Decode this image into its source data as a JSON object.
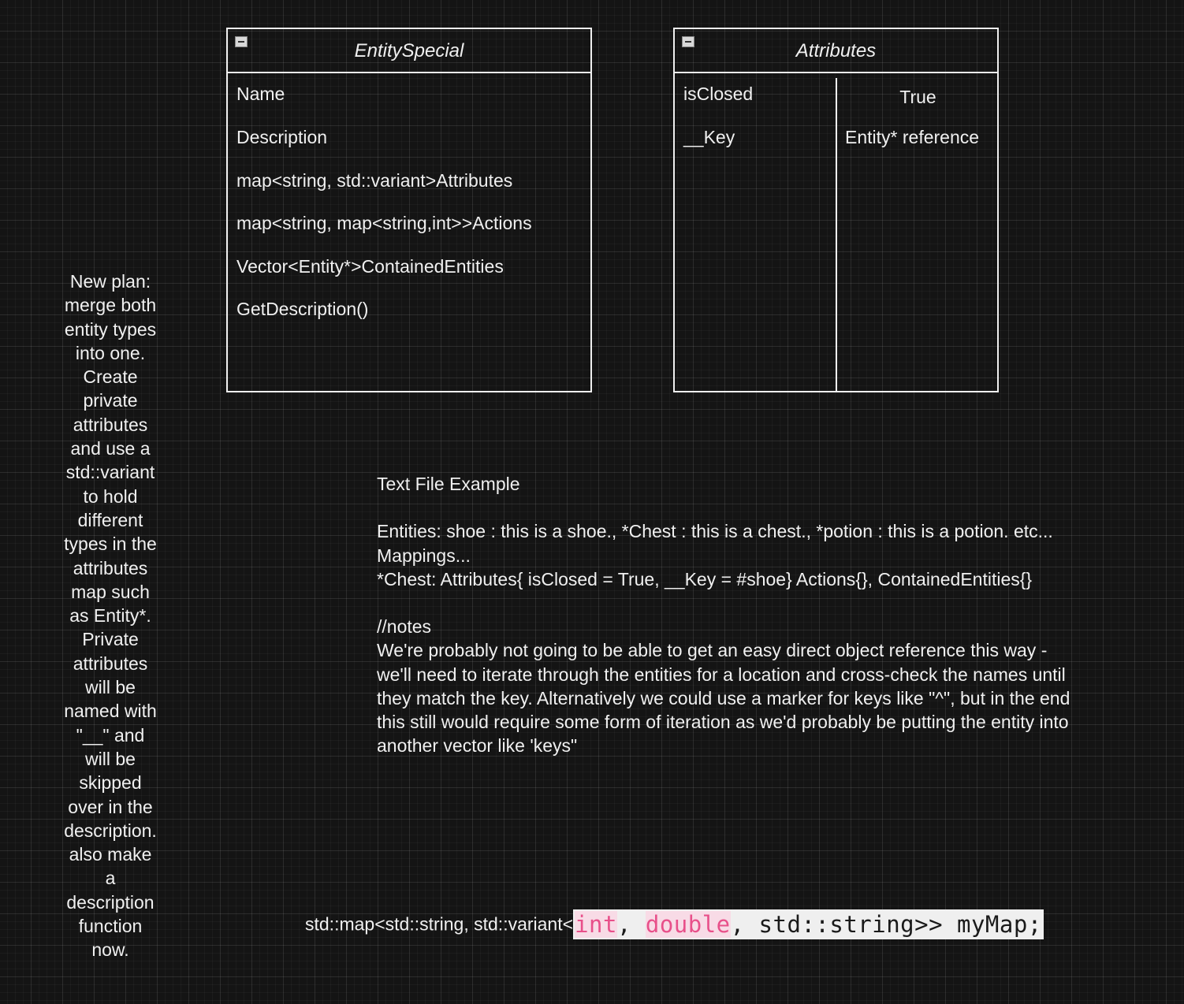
{
  "entity_box": {
    "title": "EntitySpecial",
    "rows": [
      "Name",
      "Description",
      "map<string, std::variant>Attributes",
      "map<string, map<string,int>>Actions",
      "Vector<Entity*>ContainedEntities",
      "GetDescription()"
    ]
  },
  "attributes_box": {
    "title": "Attributes",
    "keys": [
      "isClosed",
      "__Key"
    ],
    "values": [
      "True",
      "Entity* reference"
    ]
  },
  "side_note": {
    "lines": [
      "New plan:",
      "merge both",
      "entity types",
      "into one.",
      "Create",
      "private",
      "attributes",
      "and use a",
      "std::variant",
      "to hold",
      "different",
      "types in the",
      "attributes",
      "map such",
      "as Entity*.",
      "Private",
      "attributes",
      "will be",
      "named with",
      "\"__\" and",
      "will be",
      "skipped",
      "over in the",
      "description.",
      "also make",
      "a",
      "description",
      "function",
      "now."
    ]
  },
  "text_file": {
    "heading": "Text File Example",
    "lines": [
      "Entities: shoe : this is a shoe., *Chest : this is a chest., *potion : this is a potion. etc...",
      "Mappings...",
      "*Chest: Attributes{ isClosed = True, __Key = #shoe} Actions{}, ContainedEntities{}"
    ],
    "notes_heading": "//notes",
    "notes_lines": [
      "We're probably not going to be able to get an easy direct object reference this way -",
      "we'll need to iterate through the entities for a location and cross-check the names until",
      "they match the key. Alternatively we could use a marker for keys like \"^\", but in the end",
      "this still would require some form of iteration as we'd probably be putting the entity into",
      "another vector like 'keys\""
    ]
  },
  "code": {
    "prefix": "std::map<std::string, std::variant<",
    "kw1": "int",
    "sep1": ", ",
    "kw2": "double",
    "rest": ", std::string>> myMap;"
  }
}
